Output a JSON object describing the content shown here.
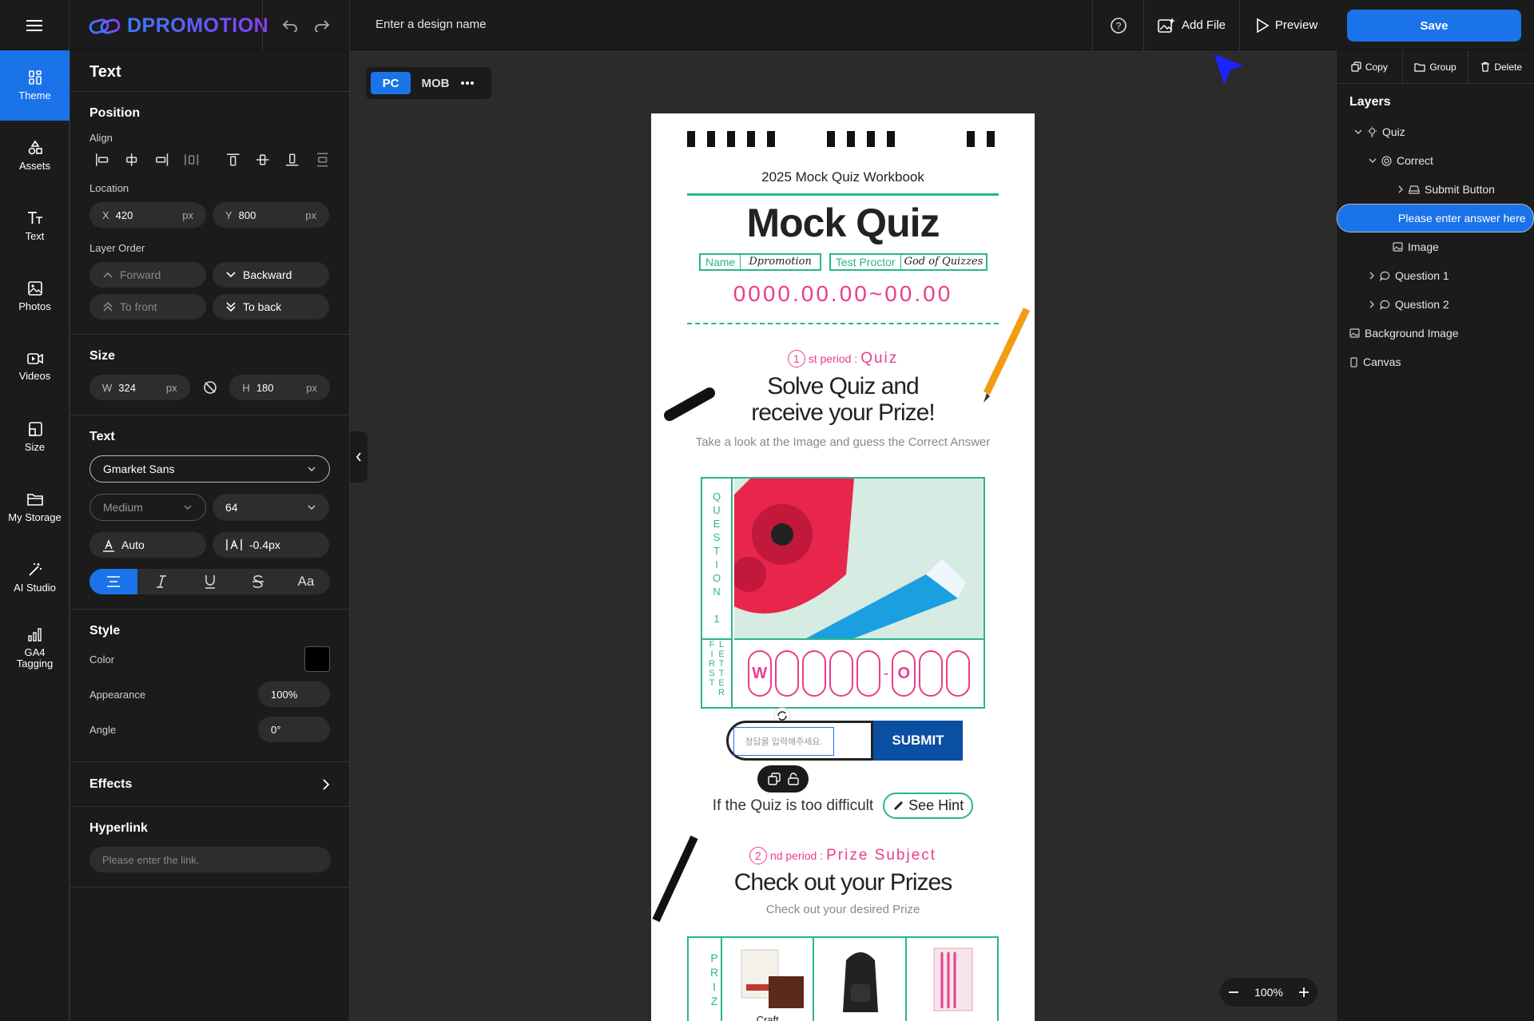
{
  "topbar": {
    "logo": "DPROMOTION",
    "design_name_placeholder": "Enter a design name",
    "add_file": "Add File",
    "preview": "Preview",
    "save": "Save"
  },
  "rail": {
    "items": [
      {
        "label": "Theme",
        "icon": "theme-icon"
      },
      {
        "label": "Assets",
        "icon": "assets-icon"
      },
      {
        "label": "Text",
        "icon": "text-icon"
      },
      {
        "label": "Photos",
        "icon": "photos-icon"
      },
      {
        "label": "Videos",
        "icon": "videos-icon"
      },
      {
        "label": "Size",
        "icon": "size-icon"
      },
      {
        "label": "My Storage",
        "icon": "folder-icon"
      },
      {
        "label": "AI Studio",
        "icon": "magic-wand-icon"
      },
      {
        "label": "GA4 Tagging",
        "icon": "bar-chart-icon"
      }
    ]
  },
  "props": {
    "title": "Text",
    "position": {
      "heading": "Position",
      "align_label": "Align",
      "location_label": "Location",
      "x_key": "X",
      "x_value": "420",
      "x_unit": "px",
      "y_key": "Y",
      "y_value": "800",
      "y_unit": "px",
      "layer_order_label": "Layer Order",
      "forward": "Forward",
      "backward": "Backward",
      "to_front": "To front",
      "to_back": "To back"
    },
    "size": {
      "heading": "Size",
      "w_key": "W",
      "w_value": "324",
      "w_unit": "px",
      "h_key": "H",
      "h_value": "180",
      "h_unit": "px"
    },
    "text": {
      "heading": "Text",
      "font_family": "Gmarket Sans",
      "font_weight": "Medium",
      "font_size": "64",
      "line_height": "Auto",
      "letter_spacing": "-0.4px",
      "case_glyph": "Aa"
    },
    "style": {
      "heading": "Style",
      "color_label": "Color",
      "color_value": "#000000",
      "appearance_label": "Appearance",
      "appearance_value": "100%",
      "angle_label": "Angle",
      "angle_value": "0°"
    },
    "effects": "Effects",
    "hyperlink": {
      "heading": "Hyperlink",
      "placeholder": "Please enter the link."
    }
  },
  "canvas_toolbar": {
    "pc": "PC",
    "mob": "MOB"
  },
  "zoom": {
    "value": "100%"
  },
  "canvas": {
    "workbook": "2025 Mock Quiz Workbook",
    "title": "Mock Quiz",
    "name_label": "Name",
    "name_value": "Dpromotion",
    "proctor_label": "Test Proctor",
    "proctor_value": "God of Quizzes",
    "date_code": "0000.00.00~00.00",
    "period1_num": "1",
    "period1_suffix": "st period :",
    "period1_name": "Quiz",
    "headline1": "Solve Quiz and",
    "headline2": "receive your Prize!",
    "sub1": "Take a look at the Image and guess the Correct Answer",
    "question_vertical": "QUESTION 1",
    "first_letter_vertical": "FIRST LETTER",
    "answer_first": "W",
    "answer_mid": "O",
    "input_placeholder": "정답을 입력해주세요.",
    "submit": "SUBMIT",
    "hint_prompt": "If the Quiz is too difficult",
    "hint_button": "See Hint",
    "period2_num": "2",
    "period2_suffix": "nd period :",
    "period2_name": "Prize Subject",
    "headline3": "Check out your Prizes",
    "sub2": "Check out your desired Prize",
    "prize_vertical": "PRIZ",
    "prize1_label": "Craft"
  },
  "layers": {
    "tools": {
      "copy": "Copy",
      "group": "Group",
      "delete": "Delete"
    },
    "title": "Layers",
    "items": [
      {
        "label": "Quiz"
      },
      {
        "label": "Correct"
      },
      {
        "label": "Submit Button"
      },
      {
        "label": "Please enter answer here"
      },
      {
        "label": "Image"
      },
      {
        "label": "Question 1"
      },
      {
        "label": "Question 2"
      },
      {
        "label": "Background Image"
      },
      {
        "label": "Canvas"
      }
    ]
  },
  "colors": {
    "accent": "#1a73e8",
    "pink": "#e83e8c",
    "mint": "#2bb58a",
    "submit_blue": "#0b4fa3"
  }
}
